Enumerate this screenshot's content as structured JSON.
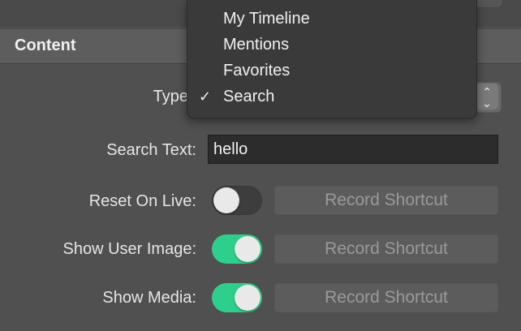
{
  "section": {
    "title": "Content"
  },
  "type_field": {
    "label": "Type",
    "menu_items": [
      "My Timeline",
      "Mentions",
      "Favorites",
      "Search"
    ],
    "selected_index": 3,
    "check_glyph": "✓",
    "stepper_up": "⌃",
    "stepper_down": "⌄"
  },
  "search_text": {
    "label": "Search Text:",
    "value": "hello"
  },
  "rows": [
    {
      "label": "Reset On Live:",
      "toggle_on": false,
      "shortcut_label": "Record Shortcut"
    },
    {
      "label": "Show User Image:",
      "toggle_on": true,
      "shortcut_label": "Record Shortcut"
    },
    {
      "label": "Show Media:",
      "toggle_on": true,
      "shortcut_label": "Record Shortcut"
    }
  ],
  "colors": {
    "toggle_on": "#2dd08a",
    "toggle_off": "#3d3d3d",
    "field_bg": "#2c2c2c"
  }
}
